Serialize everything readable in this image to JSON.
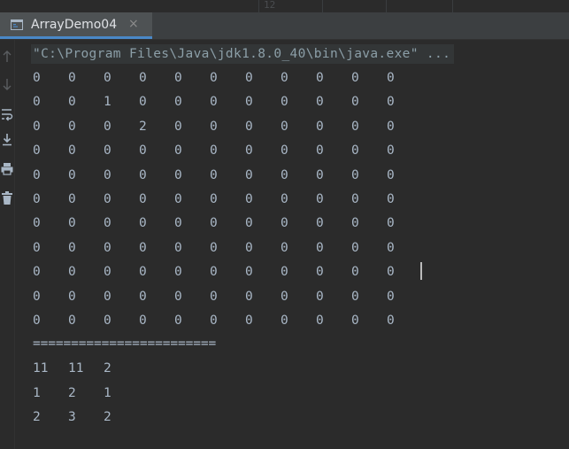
{
  "editor_strip": {
    "line_number": "12"
  },
  "tab": {
    "label": "ArrayDemo04",
    "close_glyph": "×"
  },
  "toolbar": {
    "buttons": [
      "up-arrow-icon",
      "down-arrow-icon",
      "soft-wrap-icon",
      "scroll-to-end-icon",
      "print-icon",
      "clear-all-icon"
    ]
  },
  "console": {
    "command": "\"C:\\Program Files\\Java\\jdk1.8.0_40\\bin\\java.exe\" ...",
    "grid_rows": [
      [
        "0",
        "0",
        "0",
        "0",
        "0",
        "0",
        "0",
        "0",
        "0",
        "0",
        "0"
      ],
      [
        "0",
        "0",
        "1",
        "0",
        "0",
        "0",
        "0",
        "0",
        "0",
        "0",
        "0"
      ],
      [
        "0",
        "0",
        "0",
        "2",
        "0",
        "0",
        "0",
        "0",
        "0",
        "0",
        "0"
      ],
      [
        "0",
        "0",
        "0",
        "0",
        "0",
        "0",
        "0",
        "0",
        "0",
        "0",
        "0"
      ],
      [
        "0",
        "0",
        "0",
        "0",
        "0",
        "0",
        "0",
        "0",
        "0",
        "0",
        "0"
      ],
      [
        "0",
        "0",
        "0",
        "0",
        "0",
        "0",
        "0",
        "0",
        "0",
        "0",
        "0"
      ],
      [
        "0",
        "0",
        "0",
        "0",
        "0",
        "0",
        "0",
        "0",
        "0",
        "0",
        "0"
      ],
      [
        "0",
        "0",
        "0",
        "0",
        "0",
        "0",
        "0",
        "0",
        "0",
        "0",
        "0"
      ],
      [
        "0",
        "0",
        "0",
        "0",
        "0",
        "0",
        "0",
        "0",
        "0",
        "0",
        "0"
      ],
      [
        "0",
        "0",
        "0",
        "0",
        "0",
        "0",
        "0",
        "0",
        "0",
        "0",
        "0"
      ],
      [
        "0",
        "0",
        "0",
        "0",
        "0",
        "0",
        "0",
        "0",
        "0",
        "0",
        "0"
      ]
    ],
    "separator": "========================",
    "sparse_rows": [
      [
        "11",
        "11",
        "2"
      ],
      [
        "1",
        "2",
        "1"
      ],
      [
        "2",
        "3",
        "2"
      ]
    ]
  },
  "colors": {
    "background": "#2b2b2b",
    "tab_bar": "#3c3f41",
    "active_tab": "#4e5254",
    "tab_accent": "#4a88c7",
    "console_text": "#a9b7c6",
    "command_text": "#8c9fa8"
  }
}
